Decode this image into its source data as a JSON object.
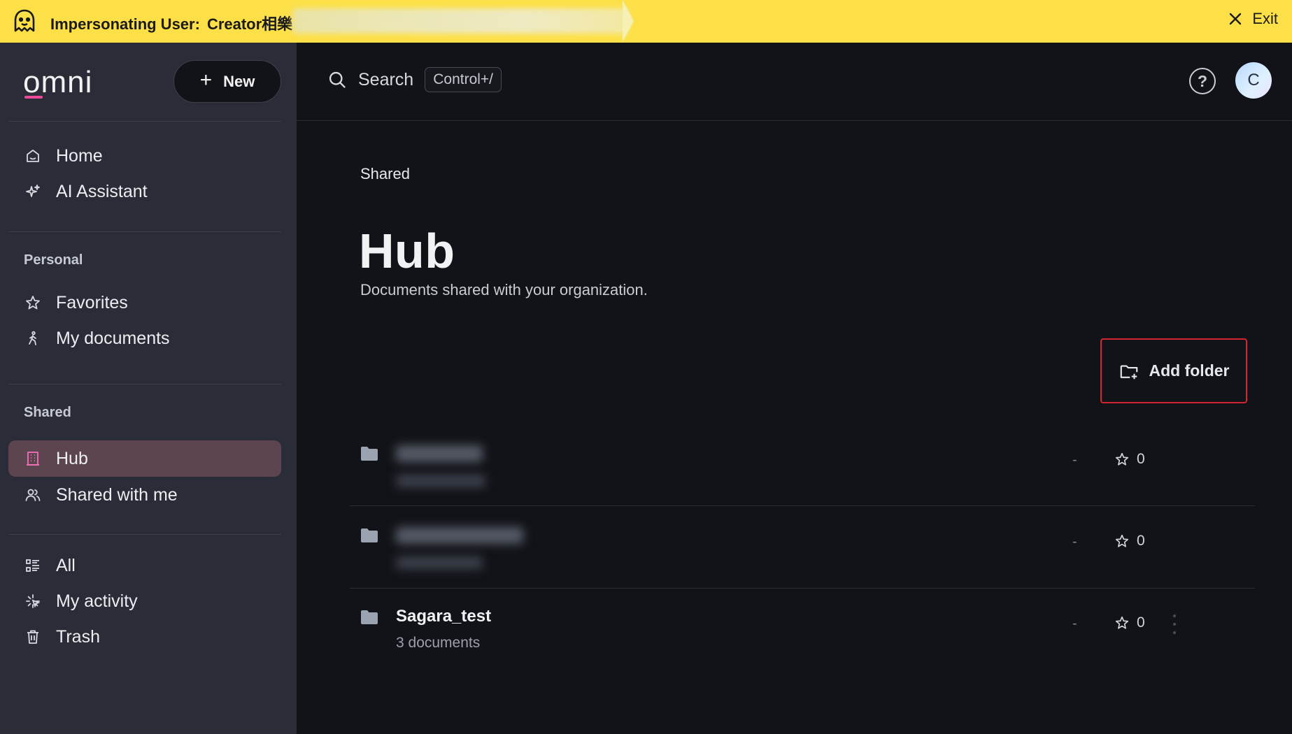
{
  "banner": {
    "label": "Impersonating User:",
    "user": "Creator相樂",
    "exit_label": "Exit",
    "color": "#fde047"
  },
  "sidebar": {
    "logo": "omni",
    "new_label": "New",
    "items_top": [
      {
        "label": "Home",
        "icon": "home-icon"
      },
      {
        "label": "AI Assistant",
        "icon": "sparkles-icon"
      }
    ],
    "personal_label": "Personal",
    "items_personal": [
      {
        "label": "Favorites",
        "icon": "star-icon"
      },
      {
        "label": "My documents",
        "icon": "person-walking-icon"
      }
    ],
    "shared_label": "Shared",
    "items_shared": [
      {
        "label": "Hub",
        "icon": "building-icon",
        "active": true
      },
      {
        "label": "Shared with me",
        "icon": "users-icon"
      }
    ],
    "items_bottom": [
      {
        "label": "All",
        "icon": "list-icon"
      },
      {
        "label": "My activity",
        "icon": "activity-icon"
      },
      {
        "label": "Trash",
        "icon": "trash-icon"
      }
    ],
    "active_color": "#5c4450"
  },
  "header": {
    "search_label": "Search",
    "search_shortcut": "Control+/",
    "help_label": "?",
    "avatar_initial": "C"
  },
  "main": {
    "breadcrumb": "Shared",
    "title": "Hub",
    "subtitle": "Documents shared with your organization.",
    "add_folder_label": "Add folder",
    "folders": [
      {
        "name": "",
        "count": "",
        "blurred": true,
        "modified": "-",
        "favorites": "0"
      },
      {
        "name": "",
        "count": "",
        "blurred": true,
        "modified": "-",
        "favorites": "0"
      },
      {
        "name": "Sagara_test",
        "count": "3 documents",
        "blurred": false,
        "modified": "-",
        "favorites": "0"
      }
    ]
  }
}
